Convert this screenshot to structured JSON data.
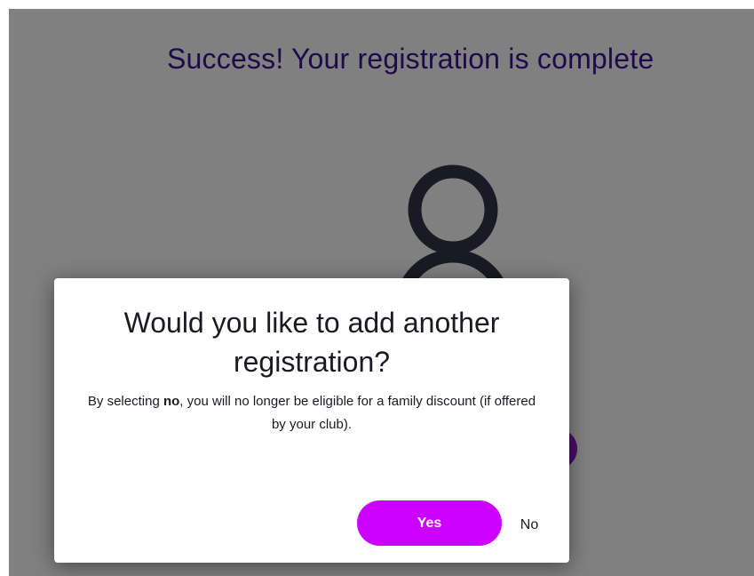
{
  "page": {
    "title": "Success! Your registration is complete",
    "user_icon": "user-outline-icon"
  },
  "modal": {
    "title": "Would you like to add another registration?",
    "body": {
      "prefix": "By selecting ",
      "emphasis": "no",
      "suffix": ", you will no longer be eligible for a family discount (if offered by your club)."
    },
    "yes_label": "Yes",
    "no_label": "No"
  },
  "colors": {
    "overlay": "#808080",
    "title_text": "#1e0a4a",
    "icon": "#1a1a24",
    "accent": "#cc00ff",
    "background_button": "#4b0a6a"
  }
}
